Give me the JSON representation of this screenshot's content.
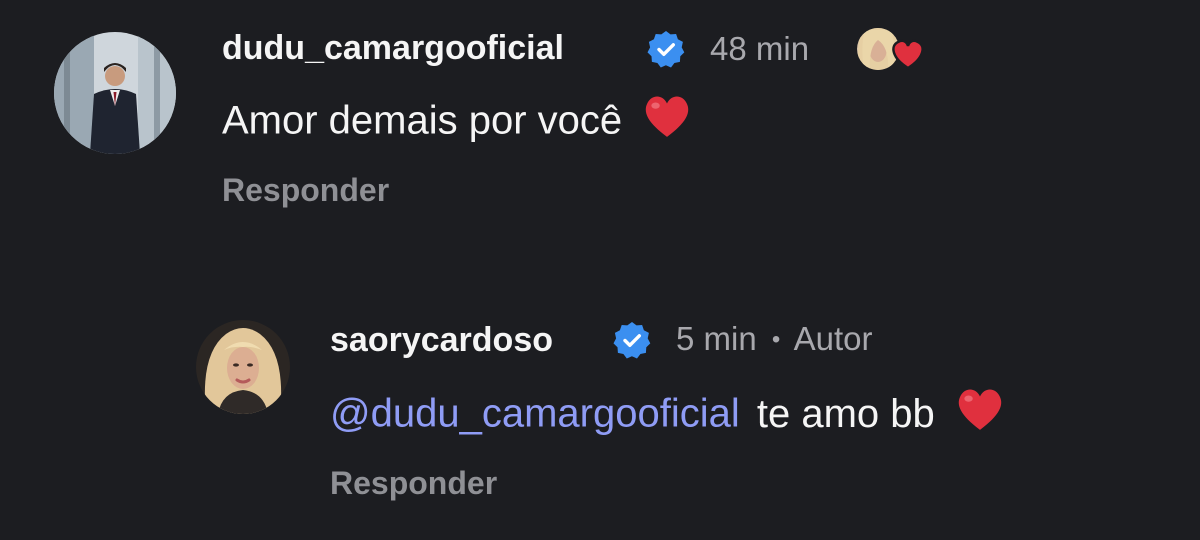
{
  "comments": [
    {
      "username": "dudu_camargooficial",
      "verified_icon": "verified-badge-icon",
      "time": "48 min",
      "text": "Amor demais por você",
      "text_emoji": "heart-emoji",
      "liked_by_author": true,
      "reply_label": "Responder"
    },
    {
      "username": "saorycardoso",
      "verified_icon": "verified-badge-icon",
      "time": "5 min",
      "separator": "•",
      "author_label": "Autor",
      "mention_prefix": "@",
      "mention": "dudu_camargooficial",
      "text": "te amo bb",
      "text_emoji": "heart-emoji",
      "reply_label": "Responder"
    }
  ],
  "colors": {
    "background": "#1c1d21",
    "verified": "#3b8ff0",
    "mention": "#8f9cf5",
    "heart": "#e0303e",
    "meta": "#a8a8ad"
  }
}
